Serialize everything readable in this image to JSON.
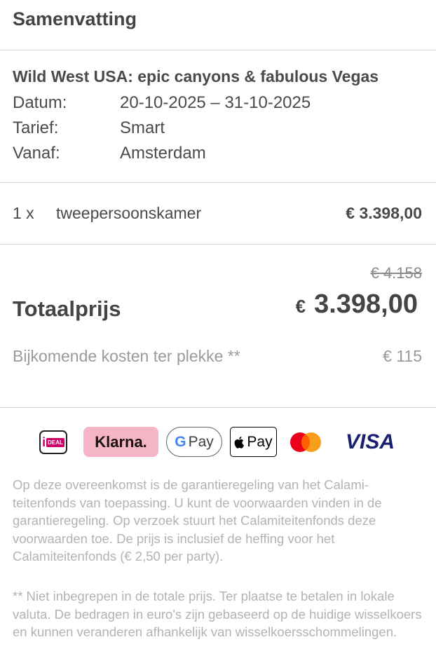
{
  "header": {
    "title": "Samenvatting"
  },
  "trip": {
    "title": "Wild West USA: epic canyons & fabulous Vegas",
    "rows": [
      {
        "label": "Datum:",
        "value": "20-10-2025 – 31-10-2025"
      },
      {
        "label": "Tarief:",
        "value": "Smart"
      },
      {
        "label": "Vanaf:",
        "value": "Amsterdam"
      }
    ]
  },
  "line_item": {
    "quantity": "1 x",
    "description": "tweepersoonskamer",
    "price": "€ 3.398,00"
  },
  "total": {
    "old_price": "€ 4.158",
    "label": "Totaalprijs",
    "currency": "€",
    "amount": "3.398,00",
    "extra_label": "Bijkomende kosten ter plekke **",
    "extra_value": "€ 115"
  },
  "payment_methods": {
    "ideal": {
      "i": "i",
      "text": "DEAL"
    },
    "klarna": "Klarna.",
    "gpay": {
      "g": "G",
      "text": "Pay"
    },
    "applepay": {
      "apple": "",
      "text": "Pay"
    },
    "visa": "VISA",
    "colors": {
      "ideal": "#cc0066",
      "klarna": "#f4b6c7",
      "mc_red": "#eb001b",
      "mc_orange": "#f79e1b",
      "visa": "#1a1f71"
    }
  },
  "terms": "Op deze overeenkomst is de garantieregeling van het Calami­teitenfonds van toepassing. U kunt de voorwaarden vinden in de garantieregeling. Op verzoek stuurt het Calamiteitenfonds deze voorwaarden toe. De prijs is inclusief de heffing voor het Calamiteitenfonds (€ 2,50 per party).",
  "note": "** Niet inbegrepen in de totale prijs. Ter plaatse te betalen in lokale valuta. De bedragen in euro's zijn gebaseerd op de huidi­ge wisselkoers en kunnen veranderen afhankelijk van wisselkoersschommelingen."
}
